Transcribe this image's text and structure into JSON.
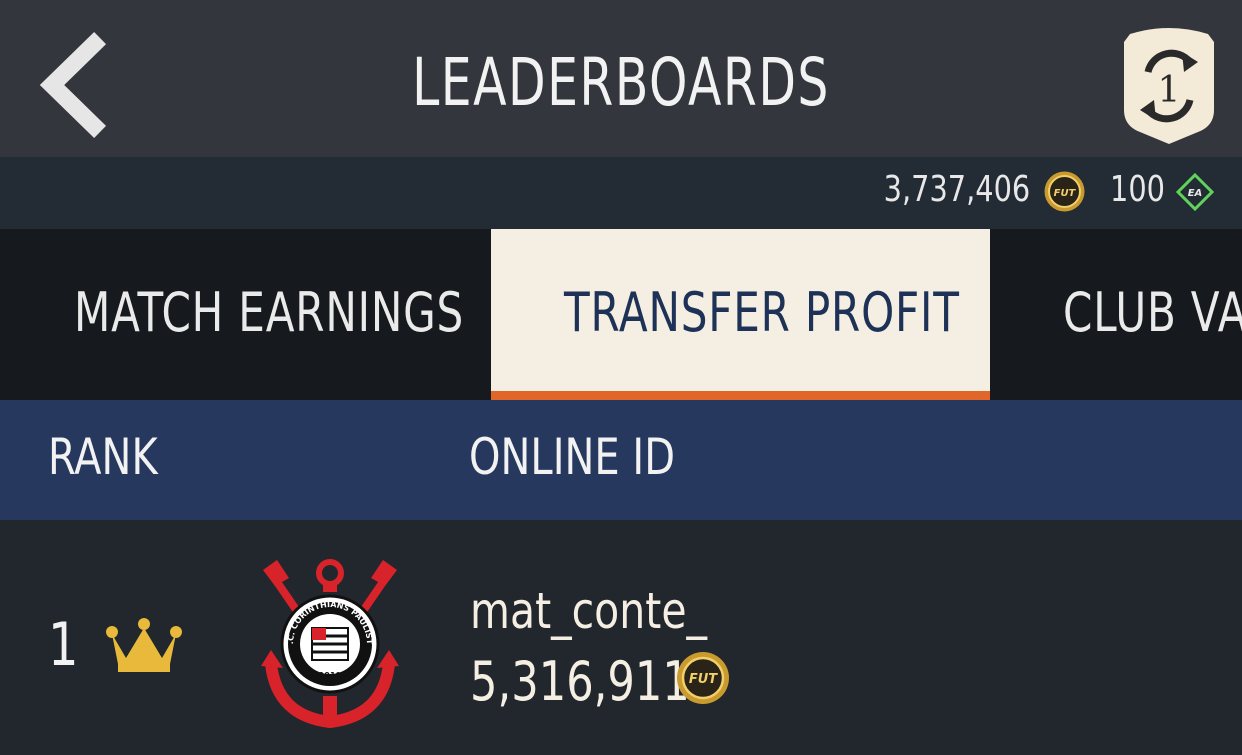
{
  "header": {
    "title": "LEADERBOARDS",
    "season_badge_value": "1"
  },
  "currency": {
    "coins": "3,737,406",
    "coin_icon_label": "FUT",
    "points": "100",
    "points_icon_label": "EA"
  },
  "tabs": [
    {
      "label": "MATCH EARNINGS",
      "active": false
    },
    {
      "label": "TRANSFER PROFIT",
      "active": true
    },
    {
      "label": "CLUB VAL",
      "active": false
    }
  ],
  "columns": {
    "rank": "RANK",
    "online_id": "ONLINE ID"
  },
  "rows": [
    {
      "rank": "1",
      "online_id": "mat_conte_",
      "value": "5,316,911",
      "coin_icon_label": "FUT",
      "club": "Corinthians",
      "crest_text": "S.C. CORINTHIANS PAULISTA",
      "crest_year": "1910"
    }
  ],
  "icons": {
    "back": "back-chevron-icon",
    "season": "season-objectives-badge-icon",
    "coin": "fut-coin-icon",
    "points": "ea-points-icon",
    "crown": "crown-icon"
  },
  "colors": {
    "header_bg": "#33363c",
    "currency_bg": "#232b35",
    "tabs_bg": "#16191d",
    "active_tab_bg": "#f5eee2",
    "active_tab_text": "#1e3258",
    "accent": "#e0662a",
    "column_header_bg": "#27385e",
    "row_bg": "#22262d",
    "gold": "#e8b93a",
    "ea_green": "#5fd35a"
  }
}
